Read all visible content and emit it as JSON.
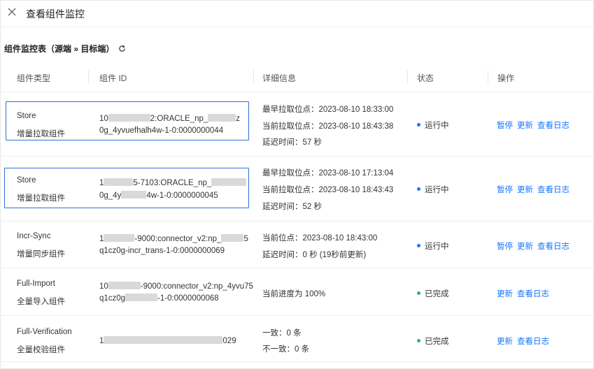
{
  "header": {
    "title": "查看组件监控"
  },
  "subheading": {
    "text": "组件监控表（源端 » 目标端）"
  },
  "table": {
    "columns": [
      "组件类型",
      "组件 ID",
      "详细信息",
      "状态",
      "操作"
    ],
    "rows": [
      {
        "type_name": "Store",
        "type_label": "增量拉取组件",
        "id_line1_a": "10",
        "id_line1_b": "2:ORACLE_np_",
        "id_line1_c": "z",
        "id_line2_a": "0g_4yvuefhalh4w-1-0:0000000044",
        "id_line2_b": "",
        "details": [
          "最早拉取位点：2023-08-10 18:33:00",
          "当前拉取位点：2023-08-10 18:43:38",
          "延迟时间：57 秒"
        ],
        "status": "运行中",
        "status_color": "#1677ff",
        "actions": [
          "暂停",
          "更新",
          "查看日志"
        ]
      },
      {
        "type_name": "Store",
        "type_label": "增量拉取组件",
        "id_line1_a": "1",
        "id_line1_b": "5-7103:ORACLE_np_",
        "id_line1_c": "",
        "id_line2_a": "0g_4y",
        "id_line2_b": "4w-1-0:0000000045",
        "details": [
          "最早拉取位点：2023-08-10 17:13:04",
          "当前拉取位点：2023-08-10 18:43:43",
          "延迟时间：52 秒"
        ],
        "status": "运行中",
        "status_color": "#1677ff",
        "actions": [
          "暂停",
          "更新",
          "查看日志"
        ]
      },
      {
        "type_name": "Incr-Sync",
        "type_label": "增量同步组件",
        "id_line1_a": "1",
        "id_line1_b": "-9000:connector_v2:np_",
        "id_line1_c": "5",
        "id_line2_a": "q1cz0g-incr_trans-1-0:0000000069",
        "id_line2_b": "",
        "details": [
          "当前位点：2023-08-10 18:43:00",
          "延迟时间：0 秒 (19秒前更新)"
        ],
        "status": "运行中",
        "status_color": "#1677ff",
        "actions": [
          "暂停",
          "更新",
          "查看日志"
        ]
      },
      {
        "type_name": "Full-Import",
        "type_label": "全量导入组件",
        "id_line1_a": "10",
        "id_line1_b": "-9000:connector_v2:np_4yvu75",
        "id_line1_c": "",
        "id_line2_a": "q1cz0g",
        "id_line2_b": "-1-0:0000000068",
        "details": [
          "当前进度为 100%"
        ],
        "status": "已完成",
        "status_color": "#2bb673",
        "actions": [
          "更新",
          "查看日志"
        ]
      },
      {
        "type_name": "Full-Verification",
        "type_label": "全量校验组件",
        "id_line1_a": "1",
        "id_line1_b": "029",
        "id_line1_c": "",
        "id_line2_a": "",
        "id_line2_b": "",
        "details": [
          "一致：0 条",
          "不一致：0 条"
        ],
        "status": "已完成",
        "status_color": "#2bb673",
        "actions": [
          "更新",
          "查看日志"
        ]
      }
    ]
  }
}
